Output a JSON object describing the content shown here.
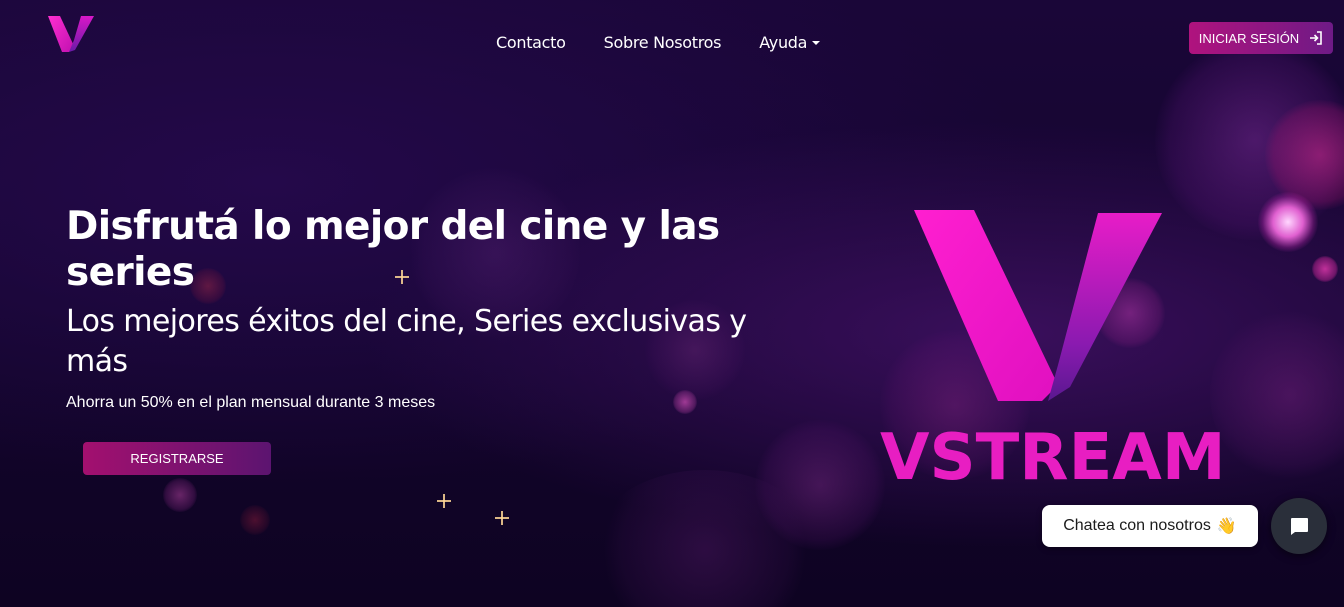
{
  "nav": {
    "links": [
      "Contacto",
      "Sobre Nosotros"
    ],
    "dropdown_label": "Ayuda",
    "login_label": "INICIAR SESIÓN"
  },
  "hero": {
    "title": "Disfrutá lo mejor del cine y las series",
    "subtitle": "Los mejores éxitos del cine, Series exclusivas y más",
    "promo": "Ahorra un 50% en el plan mensual durante 3 meses",
    "register_label": "REGISTRARSE"
  },
  "brand": {
    "wordmark": "VSTREAM"
  },
  "chat": {
    "label": "Chatea con nosotros",
    "emoji": "👋"
  },
  "colors": {
    "accent": "#e81ec2",
    "background": "#14052e",
    "button_gradient_start": "#b0137e",
    "button_gradient_end": "#6e1a86"
  }
}
